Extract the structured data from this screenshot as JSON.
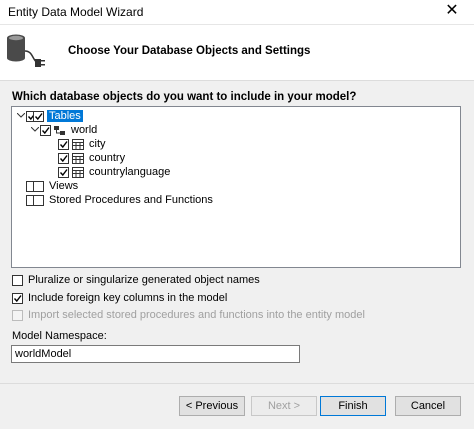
{
  "window": {
    "title": "Entity Data Model Wizard"
  },
  "header": {
    "heading": "Choose Your Database Objects and Settings",
    "icon": "database-connection-icon"
  },
  "tree": {
    "question": "Which database objects do you want to include in your model?",
    "tables_label": "Tables",
    "schema_label": "world",
    "table_items": [
      "city",
      "country",
      "countrylanguage"
    ],
    "views_label": "Views",
    "procs_label": "Stored Procedures and Functions"
  },
  "options": {
    "pluralize": {
      "label": "Pluralize or singularize generated object names",
      "checked": false
    },
    "foreign_keys": {
      "label": "Include foreign key columns in the model",
      "checked": true
    },
    "import_procs": {
      "label": "Import selected stored procedures and functions into the entity model",
      "checked": false,
      "enabled": false
    }
  },
  "namespace": {
    "label": "Model Namespace:",
    "value": "worldModel"
  },
  "buttons": {
    "previous": "< Previous",
    "next": "Next >",
    "finish": "Finish",
    "cancel": "Cancel"
  }
}
